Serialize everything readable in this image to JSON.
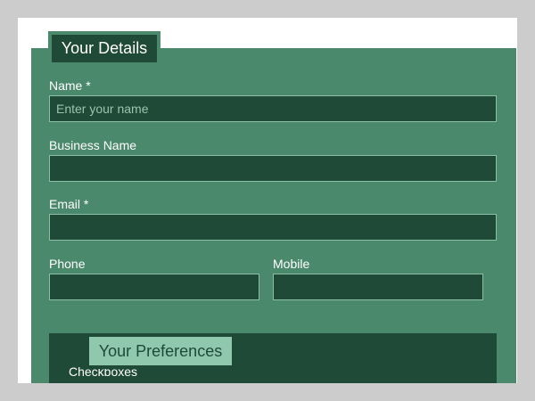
{
  "your_details": {
    "legend": "Your Details",
    "name": {
      "label": "Name",
      "required_mark": "*",
      "placeholder": "Enter your name",
      "value": ""
    },
    "business_name": {
      "label": "Business Name",
      "value": ""
    },
    "email": {
      "label": "Email",
      "required_mark": "*",
      "value": ""
    },
    "phone": {
      "label": "Phone",
      "value": ""
    },
    "mobile": {
      "label": "Mobile",
      "value": ""
    }
  },
  "your_preferences": {
    "legend": "Your Preferences",
    "checkboxes_label": "Checkboxes"
  },
  "colors": {
    "page_background": "#cccccc",
    "panel_green": "#4b896c",
    "dark_green": "#1f4a37",
    "light_green": "#8fc8ad",
    "input_border": "#8cc0a6"
  }
}
